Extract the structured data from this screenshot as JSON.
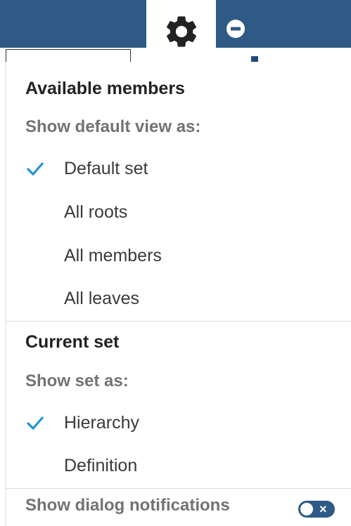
{
  "header": {
    "settings_icon": "gear-icon",
    "collapse_icon": "minus-circle-icon",
    "bar_color": "#2e5a85"
  },
  "menu": {
    "available_members": {
      "title": "Available members",
      "subheading": "Show default view as:",
      "options": [
        {
          "label": "Default set",
          "selected": true
        },
        {
          "label": "All roots",
          "selected": false
        },
        {
          "label": "All members",
          "selected": false
        },
        {
          "label": "All leaves",
          "selected": false
        }
      ]
    },
    "current_set": {
      "title": "Current set",
      "subheading": "Show set as:",
      "options": [
        {
          "label": "Hierarchy",
          "selected": true
        },
        {
          "label": "Definition",
          "selected": false
        }
      ]
    },
    "notifications": {
      "label": "Show dialog notifications",
      "toggle_on": false,
      "toggle_mark": "×"
    },
    "check_color": "#1e96d8"
  }
}
